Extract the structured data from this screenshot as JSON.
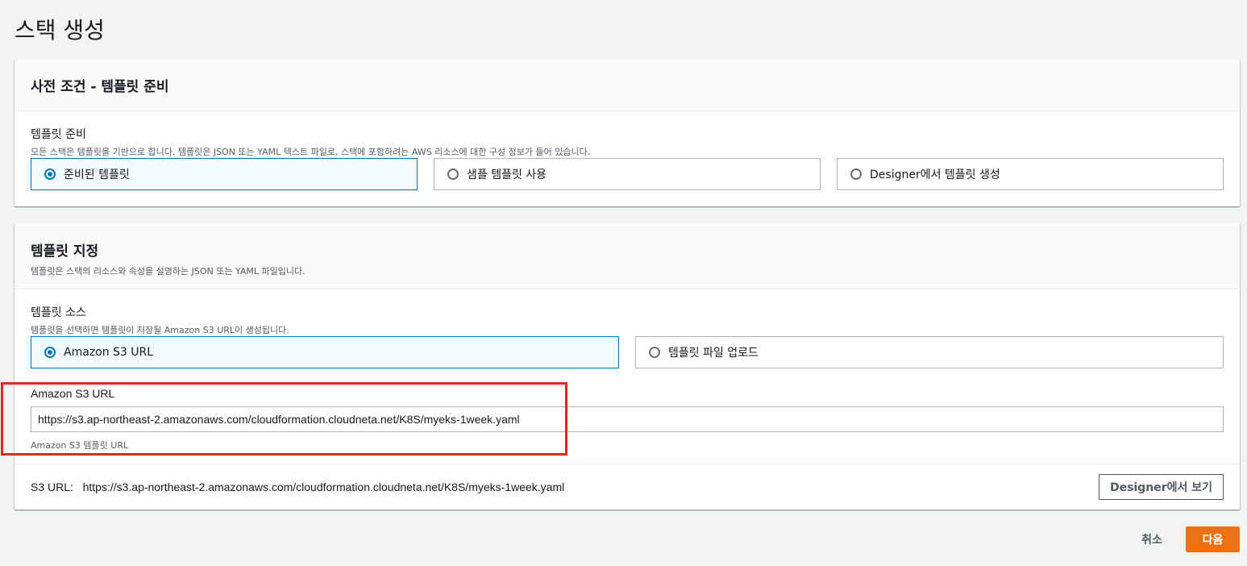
{
  "page": {
    "title": "스택 생성"
  },
  "prereq": {
    "title": "사전 조건 - 템플릿 준비",
    "field_label": "템플릿 준비",
    "field_desc": "모든 스택은 템플릿을 기반으로 합니다. 템플릿은 JSON 또는 YAML 텍스트 파일로, 스택에 포함하려는 AWS 리소스에 대한 구성 정보가 들어 있습니다.",
    "options": [
      {
        "label": "준비된 템플릿",
        "selected": true
      },
      {
        "label": "샘플 템플릿 사용",
        "selected": false
      },
      {
        "label": "Designer에서 템플릿 생성",
        "selected": false
      }
    ]
  },
  "specify": {
    "title": "템플릿 지정",
    "desc": "템플릿은 스택의 리소스와 속성을 설명하는 JSON 또는 YAML 파일입니다.",
    "source_label": "템플릿 소스",
    "source_desc": "템플릿을 선택하면 템플릿이 저장될 Amazon S3 URL이 생성됩니다.",
    "source_options": [
      {
        "label": "Amazon S3 URL",
        "selected": true
      },
      {
        "label": "템플릿 파일 업로드",
        "selected": false
      }
    ],
    "url_label": "Amazon S3 URL",
    "url_value": "https://s3.ap-northeast-2.amazonaws.com/cloudformation.cloudneta.net/K8S/myeks-1week.yaml",
    "url_hint": "Amazon S3 템플릿 URL",
    "s3_url_prefix": "S3 URL:",
    "s3_url_value": "https://s3.ap-northeast-2.amazonaws.com/cloudformation.cloudneta.net/K8S/myeks-1week.yaml",
    "designer_button": "Designer에서 보기"
  },
  "footer": {
    "cancel": "취소",
    "next": "다음"
  },
  "colors": {
    "accent": "#0073bb",
    "primary": "#ec7211",
    "highlight": "#d92a1b"
  }
}
